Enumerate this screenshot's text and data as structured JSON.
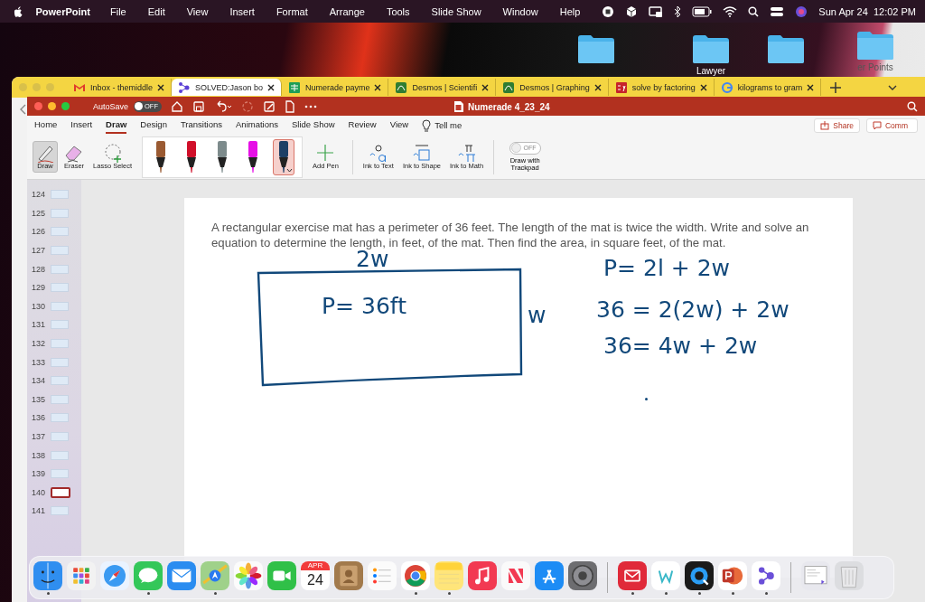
{
  "menubar": {
    "app": "PowerPoint",
    "menus": [
      "File",
      "Edit",
      "View",
      "Insert",
      "Format",
      "Arrange",
      "Tools",
      "Slide Show"
    ],
    "menus_right": [
      "Window",
      "Help"
    ],
    "clock": "Sun Apr 24  12:02 PM"
  },
  "desktop_folders": [
    {
      "kind": "folder"
    },
    {
      "kind": "folder",
      "label": "Lawyer"
    },
    {
      "kind": "folder"
    },
    {
      "kind": "folder",
      "label": "er Points"
    }
  ],
  "browser_tabs": [
    {
      "title": "Inbox - themiddle",
      "kind": "mail",
      "selected": false
    },
    {
      "title": "SOLVED:Jason bo",
      "kind": "dots",
      "selected": true
    },
    {
      "title": "Numerade payme",
      "kind": "sheet",
      "selected": false
    },
    {
      "title": "Desmos | Scientifi",
      "kind": "desmos",
      "selected": false
    },
    {
      "title": "Desmos | Graphing",
      "kind": "desmos",
      "selected": false
    },
    {
      "title": "solve by factoring",
      "kind": "sy",
      "selected": false
    },
    {
      "title": "kilograms to gram",
      "kind": "google",
      "selected": false
    }
  ],
  "powerpoint": {
    "autosave": {
      "label": "AutoSave",
      "state": "OFF",
      "on": false
    },
    "title": "Numerade 4_23_24",
    "ribbon_tabs": [
      {
        "label": "Home",
        "selected": false
      },
      {
        "label": "Insert",
        "selected": false
      },
      {
        "label": "Draw",
        "selected": true
      },
      {
        "label": "Design",
        "selected": false
      },
      {
        "label": "Transitions",
        "selected": false
      },
      {
        "label": "Animations",
        "selected": false
      },
      {
        "label": "Slide Show",
        "selected": false
      },
      {
        "label": "Review",
        "selected": false
      },
      {
        "label": "View",
        "selected": false
      }
    ],
    "tell_me": "Tell me",
    "share": "Share",
    "comments": "Comm",
    "tools": [
      {
        "label": "Draw",
        "kind": "draw",
        "selected": true
      },
      {
        "label": "Eraser",
        "kind": "eraser",
        "selected": false
      },
      {
        "label": "Lasso Select",
        "kind": "lasso",
        "selected": false
      }
    ],
    "pens": [
      {
        "color": "#9a5a32",
        "selected": false
      },
      {
        "color": "#d0102a",
        "selected": false
      },
      {
        "color": "#7d8b8c",
        "selected": false
      },
      {
        "color": "#e610e6",
        "selected": false
      },
      {
        "color": "#1d3f66",
        "selected": true
      }
    ],
    "add_pen": "Add Pen",
    "ink_tools": [
      {
        "label": "Ink to Text",
        "kind": "text"
      },
      {
        "label": "Ink to Shape",
        "kind": "shape"
      },
      {
        "label": "Ink to Math",
        "kind": "math"
      }
    ],
    "trackpad": {
      "label": "Draw with Trackpad",
      "state": "OFF",
      "on": false
    },
    "slides": [
      {
        "number": "124",
        "selected": false
      },
      {
        "number": "125",
        "selected": false
      },
      {
        "number": "126",
        "selected": false
      },
      {
        "number": "127",
        "selected": false
      },
      {
        "number": "128",
        "selected": false
      },
      {
        "number": "129",
        "selected": false
      },
      {
        "number": "130",
        "selected": false
      },
      {
        "number": "131",
        "selected": false
      },
      {
        "number": "132",
        "selected": false
      },
      {
        "number": "133",
        "selected": false
      },
      {
        "number": "134",
        "selected": false
      },
      {
        "number": "135",
        "selected": false
      },
      {
        "number": "136",
        "selected": false
      },
      {
        "number": "137",
        "selected": false
      },
      {
        "number": "138",
        "selected": false
      },
      {
        "number": "139",
        "selected": false
      },
      {
        "number": "140",
        "selected": true
      },
      {
        "number": "141",
        "selected": false
      }
    ],
    "slide": {
      "question": "A rectangular exercise mat has a perimeter of 36 feet. The length of the mat is twice the width. Write and solve an equation to determine the length, in feet, of the mat. Then find the area, in square feet, of the mat.",
      "ink": [
        "2w",
        "P= 36ft",
        "w",
        "P= 2l + 2w",
        "36 = 2(2w) + 2w",
        "36= 4w + 2w"
      ]
    }
  },
  "dock": [
    {
      "kind": "finder",
      "running": true
    },
    {
      "kind": "launchpad",
      "running": false
    },
    {
      "kind": "safari",
      "running": false
    },
    {
      "kind": "messages",
      "running": true
    },
    {
      "kind": "mail",
      "running": false
    },
    {
      "kind": "maps",
      "running": true
    },
    {
      "kind": "photos",
      "running": false
    },
    {
      "kind": "facetime",
      "running": false
    },
    {
      "kind": "calendar",
      "running": false,
      "month": "APR",
      "day": "24"
    },
    {
      "kind": "contacts",
      "running": false
    },
    {
      "kind": "reminders",
      "running": false
    },
    {
      "kind": "chrome",
      "running": true
    },
    {
      "kind": "notes",
      "running": true
    },
    {
      "kind": "music",
      "running": false
    },
    {
      "kind": "news",
      "running": false
    },
    {
      "kind": "appstore",
      "running": false
    },
    {
      "kind": "settings",
      "running": false
    },
    {
      "kind": "separator"
    },
    {
      "kind": "mailred",
      "running": true
    },
    {
      "kind": "wapp",
      "running": true
    },
    {
      "kind": "quicktime",
      "running": true
    },
    {
      "kind": "powerpoint",
      "running": true
    },
    {
      "kind": "dotsapp",
      "running": true
    },
    {
      "kind": "separator"
    },
    {
      "kind": "window",
      "running": false
    },
    {
      "kind": "trash",
      "running": false
    }
  ]
}
